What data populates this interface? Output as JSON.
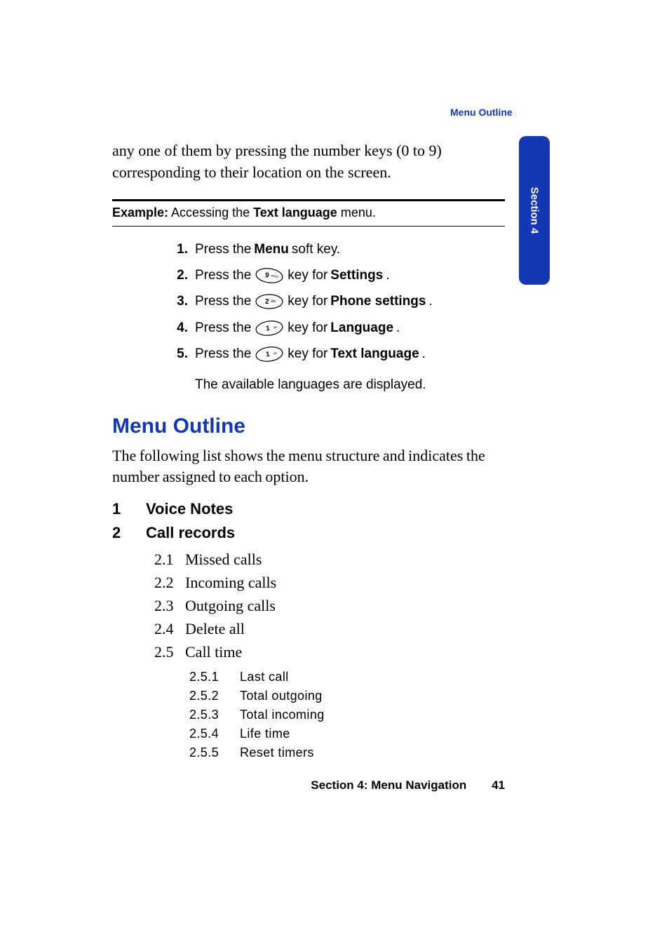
{
  "header_link": "Menu Outline",
  "tab_label": "Section 4",
  "intro_text": "any one of them by pressing the number keys (0 to 9) corresponding to their location on the screen.",
  "example": {
    "label": "Example:",
    "text_before": " Accessing the ",
    "bold": "Text language",
    "text_after": " menu."
  },
  "steps": [
    {
      "n": "1.",
      "pre": "Press the ",
      "bold": "Menu",
      "post": " soft key.",
      "key": null
    },
    {
      "n": "2.",
      "pre": "Press the ",
      "bold": "Settings",
      "post": ".",
      "key": "9",
      "mid": " key for "
    },
    {
      "n": "3.",
      "pre": "Press the ",
      "bold": "Phone settings",
      "post": ".",
      "key": "2",
      "mid": " key for "
    },
    {
      "n": "4.",
      "pre": "Press the ",
      "bold": "Language",
      "post": ".",
      "key": "1",
      "mid": " key for "
    },
    {
      "n": "5.",
      "pre": "Press the ",
      "bold": "Text language",
      "post": ".",
      "key": "1",
      "mid": " key for "
    }
  ],
  "step_note": "The available languages are displayed.",
  "heading": "Menu Outline",
  "heading_para": "The following list shows the menu structure and indicates the number assigned to each option.",
  "menu": [
    {
      "n": "1",
      "label": "Voice Notes",
      "items": []
    },
    {
      "n": "2",
      "label": "Call records",
      "items": [
        {
          "n": "2.1",
          "label": "Missed calls"
        },
        {
          "n": "2.2",
          "label": "Incoming calls"
        },
        {
          "n": "2.3",
          "label": "Outgoing calls"
        },
        {
          "n": "2.4",
          "label": "Delete all"
        },
        {
          "n": "2.5",
          "label": "Call time",
          "sub": [
            {
              "n": "2.5.1",
              "label": "Last call"
            },
            {
              "n": "2.5.2",
              "label": "Total outgoing"
            },
            {
              "n": "2.5.3",
              "label": "Total incoming"
            },
            {
              "n": "2.5.4",
              "label": "Life time"
            },
            {
              "n": "2.5.5",
              "label": "Reset timers"
            }
          ]
        }
      ]
    }
  ],
  "footer": {
    "section": "Section 4: Menu Navigation",
    "page": "41"
  }
}
